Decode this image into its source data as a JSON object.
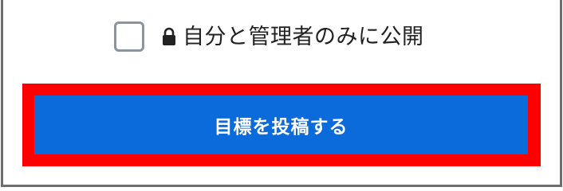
{
  "privacy": {
    "checked": false,
    "label": "自分と管理者のみに公開",
    "icon": "lock-icon"
  },
  "submit": {
    "label": "目標を投稿する"
  },
  "colors": {
    "button_bg": "#0b6bdb",
    "highlight": "#ff0000",
    "frame_border": "#6e6e6e",
    "checkbox_border": "#8c959d"
  }
}
